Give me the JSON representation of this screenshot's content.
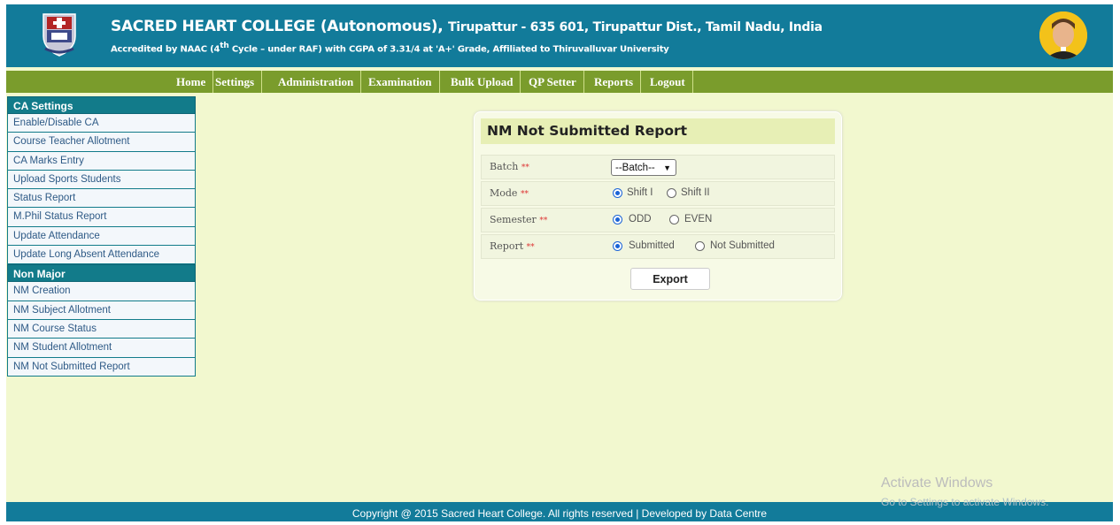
{
  "header": {
    "title_main": "SACRED HEART COLLEGE (Autonomous),",
    "title_location": "Tirupattur - 635 601, Tirupattur Dist., Tamil Nadu, India",
    "subtitle_pre": "Accredited by NAAC (4",
    "subtitle_sup": "th",
    "subtitle_post": " Cycle – under RAF) with CGPA of 3.31/4 at 'A+' Grade, Affiliated to Thiruvalluvar University"
  },
  "nav": [
    "Home",
    "Settings",
    "Administration",
    "Examination",
    "Bulk Upload",
    "QP Setter",
    "Reports",
    "Logout"
  ],
  "sidebar": {
    "ca_heading": "CA Settings",
    "ca_items": [
      "Enable/Disable CA",
      "Course Teacher Allotment",
      "CA Marks Entry",
      "Upload Sports Students",
      "Status Report",
      "M.Phil Status Report",
      "Update Attendance",
      "Update Long Absent Attendance"
    ],
    "nm_heading": "Non Major",
    "nm_items": [
      "NM Creation",
      "NM Subject Allotment",
      "NM Course Status",
      "NM Student Allotment",
      "NM Not Submitted Report"
    ]
  },
  "form": {
    "title": "NM Not Submitted Report",
    "required_mark": "**",
    "batch": {
      "label": "Batch",
      "value": "--Batch--"
    },
    "mode": {
      "label": "Mode",
      "options": [
        "Shift I",
        "Shift II"
      ],
      "selected": "Shift I"
    },
    "semester": {
      "label": "Semester",
      "options": [
        "ODD",
        "EVEN"
      ],
      "selected": "ODD"
    },
    "report": {
      "label": "Report",
      "options": [
        "Submitted",
        "Not Submitted"
      ],
      "selected": "Submitted"
    },
    "export_label": "Export"
  },
  "footer": {
    "text": "Copyright @ 2015 Sacred Heart College. All rights reserved  |  Developed by Data Centre"
  },
  "watermark": {
    "line1": "Activate Windows",
    "line2": "Go to Settings to activate Windows."
  },
  "colors": {
    "header": "#127b9a",
    "navbar": "#7a9c2c",
    "background": "#f2f8cf",
    "sidebar_head": "#127b8a"
  }
}
